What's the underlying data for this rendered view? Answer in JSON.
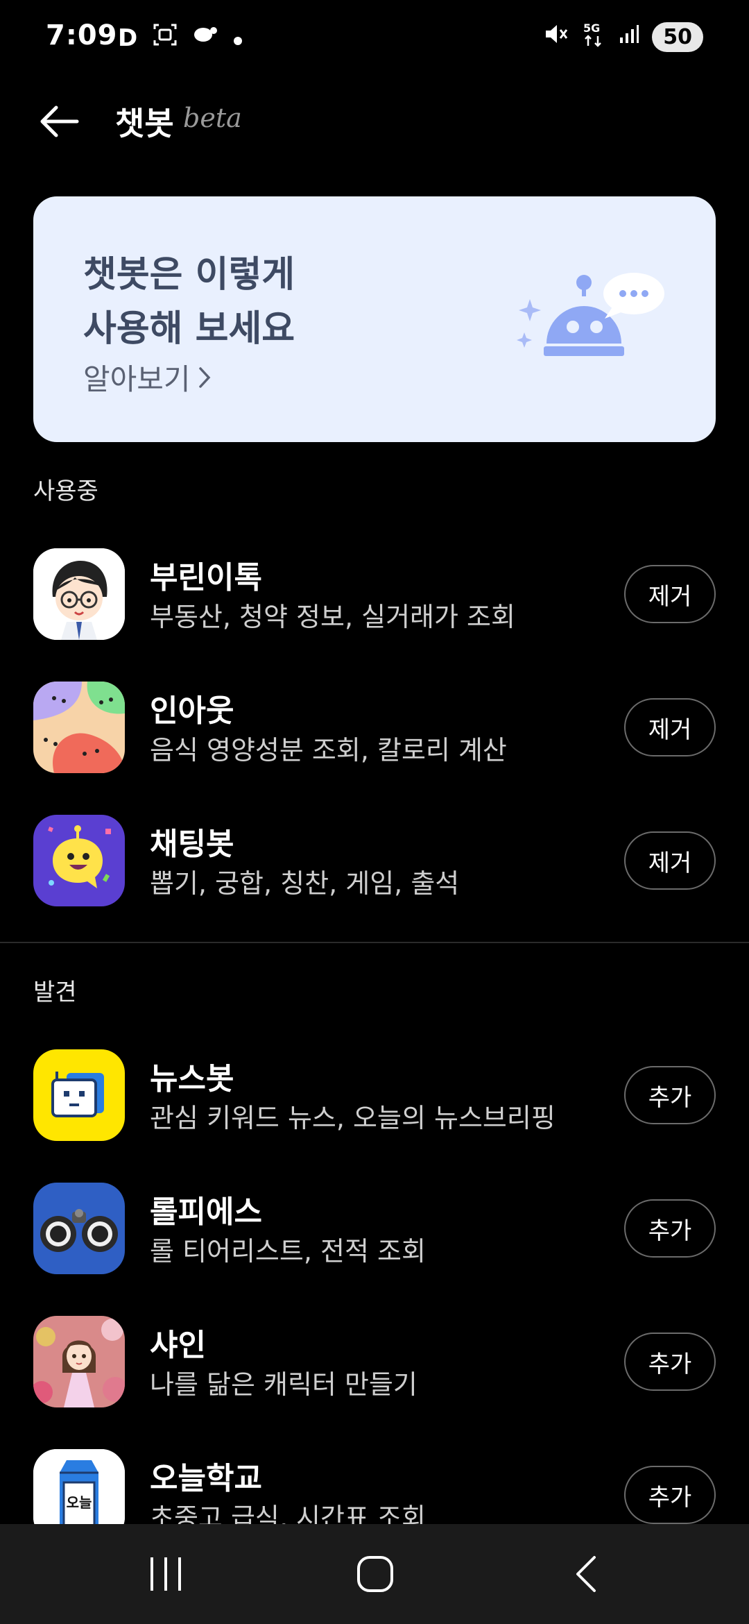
{
  "status": {
    "time": "7:09",
    "left_icons": [
      "D",
      "screenshot-icon",
      "chat-icon",
      "dot-icon"
    ],
    "right_icons": [
      "mute-icon",
      "5g-icon",
      "signal-icon"
    ],
    "battery": "50"
  },
  "header": {
    "title": "챗봇",
    "title_suffix": "beta"
  },
  "banner": {
    "line1": "챗봇은 이렇게",
    "line2": "사용해 보세요",
    "link": "알아보기",
    "colors": {
      "background": "#e9f0fe",
      "illustration": "#8fa8f4"
    }
  },
  "sections": {
    "in_use": "사용중",
    "discover": "발견"
  },
  "in_use_bots": [
    {
      "name": "부린이톡",
      "desc": "부동산, 청약 정보, 실거래가 조회",
      "action": "제거"
    },
    {
      "name": "인아웃",
      "desc": "음식 영양성분 조회, 칼로리 계산",
      "action": "제거"
    },
    {
      "name": "채팅봇",
      "desc": "뽑기, 궁합, 칭찬, 게임, 출석",
      "action": "제거"
    }
  ],
  "discover_bots": [
    {
      "name": "뉴스봇",
      "desc": "관심 키워드 뉴스, 오늘의 뉴스브리핑",
      "action": "추가"
    },
    {
      "name": "롤피에스",
      "desc": "롤 티어리스트, 전적 조회",
      "action": "추가"
    },
    {
      "name": "샤인",
      "desc": "나를 닮은 캐릭터 만들기",
      "action": "추가"
    },
    {
      "name": "오늘학교",
      "desc": "초중고 급식, 시간표 조회",
      "action": "추가",
      "icon_text": "오늘"
    }
  ],
  "nav": [
    "recents-icon",
    "home-icon",
    "back-icon"
  ]
}
